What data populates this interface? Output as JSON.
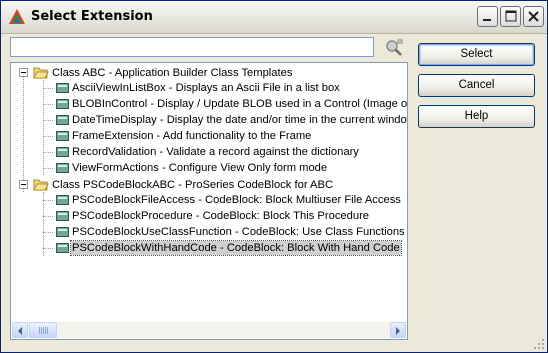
{
  "window": {
    "title": "Select Extension"
  },
  "search": {
    "value": "",
    "placeholder": ""
  },
  "tree": {
    "groups": [
      {
        "label": "Class ABC - Application Builder Class Templates",
        "items": [
          "AsciiViewInListBox - Displays an Ascii File in a list box",
          "BLOBInControl - Display / Update BLOB used in a Control (Image or Te",
          "DateTimeDisplay - Display the date and/or time in the current window",
          "FrameExtension - Add functionality to the Frame",
          "RecordValidation - Validate a record against the dictionary",
          "ViewFormActions - Configure View Only form mode"
        ]
      },
      {
        "label": "Class PSCodeBlockABC - ProSeries CodeBlock for ABC",
        "items": [
          "PSCodeBlockFileAccess - CodeBlock: Block Multiuser File Access",
          "PSCodeBlockProcedure - CodeBlock: Block This Procedure",
          "PSCodeBlockUseClassFunction - CodeBlock: Use Class Functions as",
          "PSCodeBlockWithHandCode - CodeBlock: Block With Hand Code"
        ]
      }
    ],
    "selected": "PSCodeBlockWithHandCode - CodeBlock: Block With Hand Code"
  },
  "buttons": {
    "select": "Select",
    "cancel": "Cancel",
    "help": "Help"
  }
}
